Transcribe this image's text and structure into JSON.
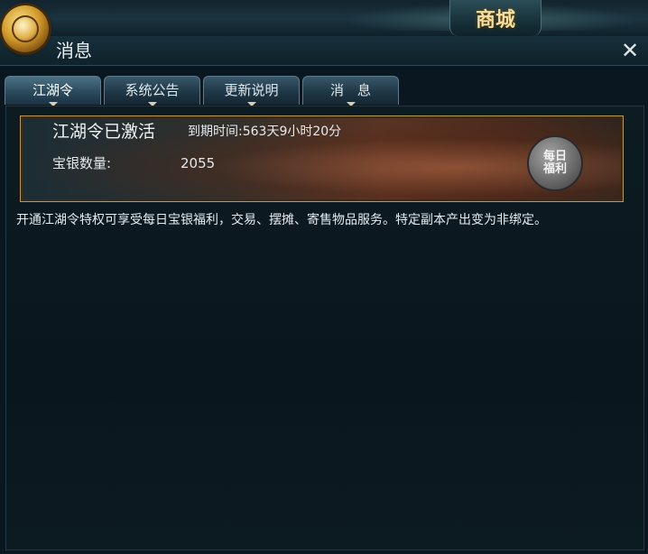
{
  "header": {
    "shop_label": "商城"
  },
  "window": {
    "title": "消息"
  },
  "tabs": [
    {
      "label": "江湖令"
    },
    {
      "label": "系统公告"
    },
    {
      "label": "更新说明"
    },
    {
      "label": "消　息"
    }
  ],
  "banner": {
    "status": "江湖令已激活",
    "expiry": "到期时间:563天9小时20分",
    "silver_label": "宝银数量:",
    "silver_value": "2055",
    "badge_text": "每日\n福利"
  },
  "description": "开通江湖令特权可享受每日宝银福利，交易、摆摊、寄售物品服务。特定副本产出变为非绑定。",
  "colors": {
    "accent_gold": "#f4dfa0",
    "panel_bg": "#0b1720",
    "banner_border": "#b99a5c"
  },
  "icons": [
    "gear-icon",
    "close-icon"
  ]
}
